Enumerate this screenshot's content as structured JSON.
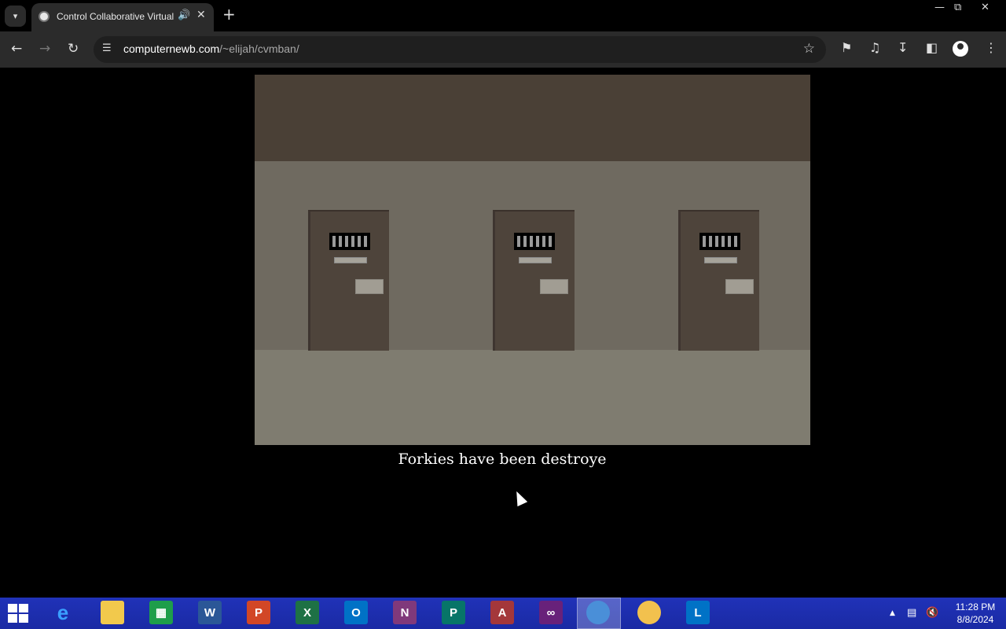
{
  "browser": {
    "tab_title": "Control Collaborative Virtual Machine",
    "url_host": "computernewb.com",
    "url_path": "/~elijah/cvmban/"
  },
  "page": {
    "caption": "Forkies have been destroye"
  },
  "taskbar": {
    "apps": [
      "Internet Explorer",
      "File Explorer",
      "Store",
      "Word",
      "PowerPoint",
      "Excel",
      "Outlook",
      "OneNote",
      "Publisher",
      "Access",
      "Visual Studio",
      "Chrome",
      "Bee app",
      "Lync"
    ],
    "clock_time": "11:28 PM",
    "clock_date": "8/8/2024"
  },
  "colors": {
    "chrome_bg": "#2b2b2b",
    "ceiling": "#4a4036",
    "wall": "#6f6a60",
    "floor": "#7f7c70",
    "door": "#4e443b",
    "taskbar": "#1c2bb0"
  }
}
